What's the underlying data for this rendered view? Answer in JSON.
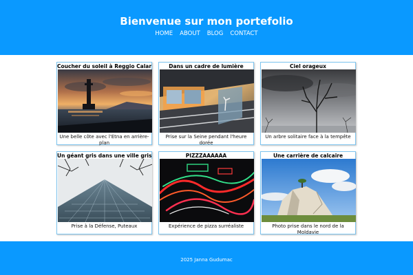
{
  "header": {
    "title": "Bienvenue sur mon portefolio",
    "nav": [
      "HOME",
      "ABOUT",
      "BLOG",
      "CONTACT"
    ]
  },
  "gallery": [
    {
      "title": "Coucher du soleil à Reggio Calaria",
      "caption": "Une belle côte avec l'Etna en arrière-plan",
      "photo": "sunset-coast"
    },
    {
      "title": "Dans un cadre de lumière",
      "caption": "Prise sur la Seine pendant l'heure dorée",
      "photo": "glass-building-reflection"
    },
    {
      "title": "Ciel orageux",
      "caption": "Un arbre solitaire face à la tempête",
      "photo": "stormy-sky-tree"
    },
    {
      "title": "Un géant gris dans une ville grise",
      "caption": "Prise à la Défense, Puteaux",
      "photo": "skyscraper-branches"
    },
    {
      "title": "PIZZZAAAAAA",
      "caption": "Expérience de pizza surréaliste",
      "photo": "neon-light-trails"
    },
    {
      "title": "Une carrière de calcaire",
      "caption": "Photo prise dans le nord de la Moldavie",
      "photo": "limestone-quarry"
    }
  ],
  "footer": {
    "copyright": "2025 Janna Gudumac"
  },
  "colors": {
    "brand": "#0a99ff",
    "card_border": "#7cc4ef"
  }
}
